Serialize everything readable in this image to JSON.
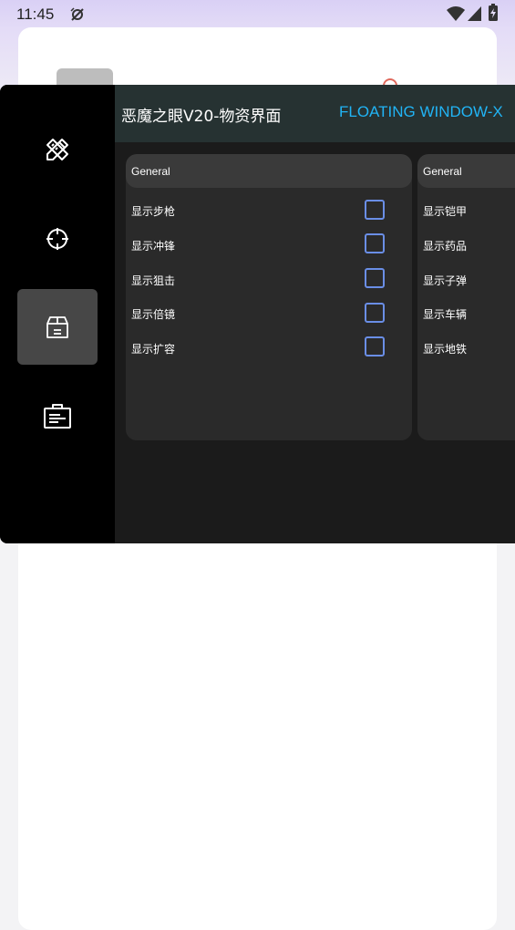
{
  "status_bar": {
    "time": "11:45",
    "icons": [
      "shield-off-icon",
      "wifi-icon",
      "cell-signal-icon",
      "battery-charging-icon"
    ]
  },
  "overlay": {
    "title": "恶魔之眼V20-物资界面",
    "subtitle": "FLOATING WINDOW-X",
    "nav_items": [
      {
        "icon": "pencil-ruler-icon",
        "active": false
      },
      {
        "icon": "crosshair-icon",
        "active": false
      },
      {
        "icon": "package-icon",
        "active": true
      },
      {
        "icon": "clipboard-icon",
        "active": false
      }
    ],
    "panels": [
      {
        "header": "General",
        "items": [
          {
            "label": "显示步枪",
            "checked": false
          },
          {
            "label": "显示冲锋",
            "checked": false
          },
          {
            "label": "显示狙击",
            "checked": false
          },
          {
            "label": "显示倍镜",
            "checked": false
          },
          {
            "label": "显示扩容",
            "checked": false
          }
        ]
      },
      {
        "header": "General",
        "items": [
          {
            "label": "显示铠甲"
          },
          {
            "label": "显示药品"
          },
          {
            "label": "显示子弹"
          },
          {
            "label": "显示车辆"
          },
          {
            "label": "显示地铁"
          }
        ]
      }
    ]
  },
  "colors": {
    "accent": "#21b4f5",
    "checkbox_border": "#6a8ee6",
    "header_bg": "#263232",
    "sidebar_bg": "#000000"
  }
}
